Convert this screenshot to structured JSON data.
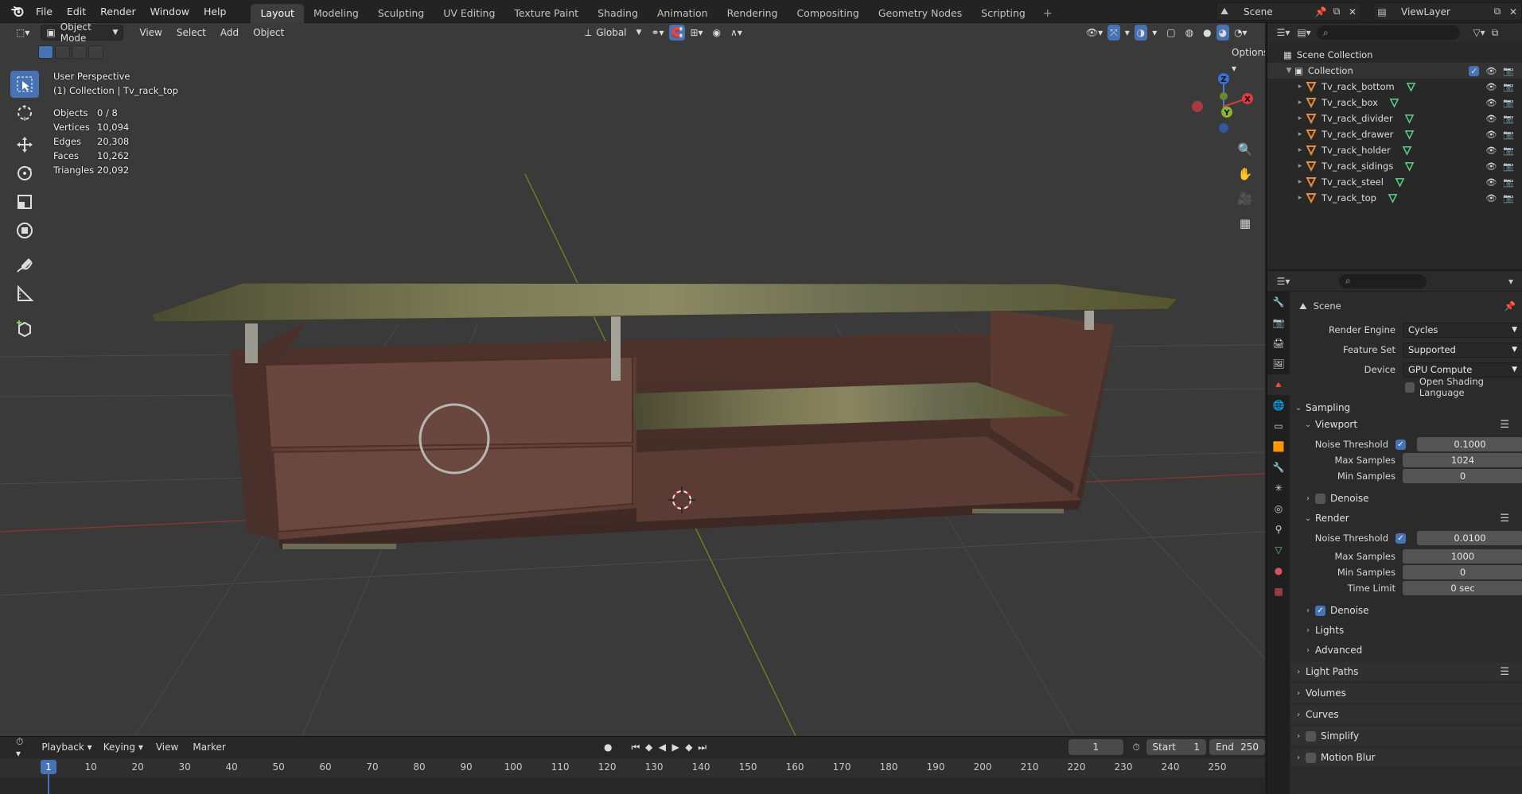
{
  "topbar": {
    "menus": [
      "File",
      "Edit",
      "Render",
      "Window",
      "Help"
    ],
    "workspaces": [
      "Layout",
      "Modeling",
      "Sculpting",
      "UV Editing",
      "Texture Paint",
      "Shading",
      "Animation",
      "Rendering",
      "Compositing",
      "Geometry Nodes",
      "Scripting"
    ],
    "active_workspace": "Layout",
    "scene_name": "Scene",
    "view_layer": "ViewLayer"
  },
  "viewport_header": {
    "mode": "Object Mode",
    "menus": [
      "View",
      "Select",
      "Add",
      "Object"
    ],
    "orientation": "Global",
    "options_label": "Options"
  },
  "viewport": {
    "perspective": "User Perspective",
    "context": "(1) Collection | Tv_rack_top",
    "stats": [
      {
        "label": "Objects",
        "value": "0 / 8"
      },
      {
        "label": "Vertices",
        "value": "10,094"
      },
      {
        "label": "Edges",
        "value": "20,308"
      },
      {
        "label": "Faces",
        "value": "10,262"
      },
      {
        "label": "Triangles",
        "value": "20,092"
      }
    ],
    "gizmo": {
      "x": "X",
      "y": "Y",
      "z": "Z"
    }
  },
  "outliner": {
    "root": "Scene Collection",
    "collection": "Collection",
    "objects": [
      "Tv_rack_bottom",
      "Tv_rack_box",
      "Tv_rack_divider",
      "Tv_rack_drawer",
      "Tv_rack_holder",
      "Tv_rack_sidings",
      "Tv_rack_steel",
      "Tv_rack_top"
    ]
  },
  "properties": {
    "context": "Scene",
    "render_engine": {
      "label": "Render Engine",
      "value": "Cycles"
    },
    "feature_set": {
      "label": "Feature Set",
      "value": "Supported"
    },
    "device": {
      "label": "Device",
      "value": "GPU Compute"
    },
    "osl": "Open Shading Language",
    "sampling": "Sampling",
    "viewport_sub": "Viewport",
    "viewport_noise_threshold": {
      "label": "Noise Threshold",
      "value": "0.1000"
    },
    "viewport_max_samples": {
      "label": "Max Samples",
      "value": "1024"
    },
    "viewport_min_samples": {
      "label": "Min Samples",
      "value": "0"
    },
    "viewport_denoise": "Denoise",
    "render_sub": "Render",
    "render_noise_threshold": {
      "label": "Noise Threshold",
      "value": "0.0100"
    },
    "render_max_samples": {
      "label": "Max Samples",
      "value": "1000"
    },
    "render_min_samples": {
      "label": "Min Samples",
      "value": "0"
    },
    "render_time_limit": {
      "label": "Time Limit",
      "value": "0 sec"
    },
    "render_denoise": "Denoise",
    "lights": "Lights",
    "advanced": "Advanced",
    "light_paths": "Light Paths",
    "volumes": "Volumes",
    "curves": "Curves",
    "simplify": "Simplify",
    "motion_blur": "Motion Blur"
  },
  "timeline": {
    "menus": [
      "Playback",
      "Keying",
      "View",
      "Marker"
    ],
    "current_frame": "1",
    "start_label": "Start",
    "start": "1",
    "end_label": "End",
    "end": "250",
    "ticks": [
      "1",
      "10",
      "20",
      "30",
      "40",
      "50",
      "60",
      "70",
      "80",
      "90",
      "100",
      "110",
      "120",
      "130",
      "140",
      "150",
      "160",
      "170",
      "180",
      "190",
      "200",
      "210",
      "220",
      "230",
      "240",
      "250"
    ]
  }
}
